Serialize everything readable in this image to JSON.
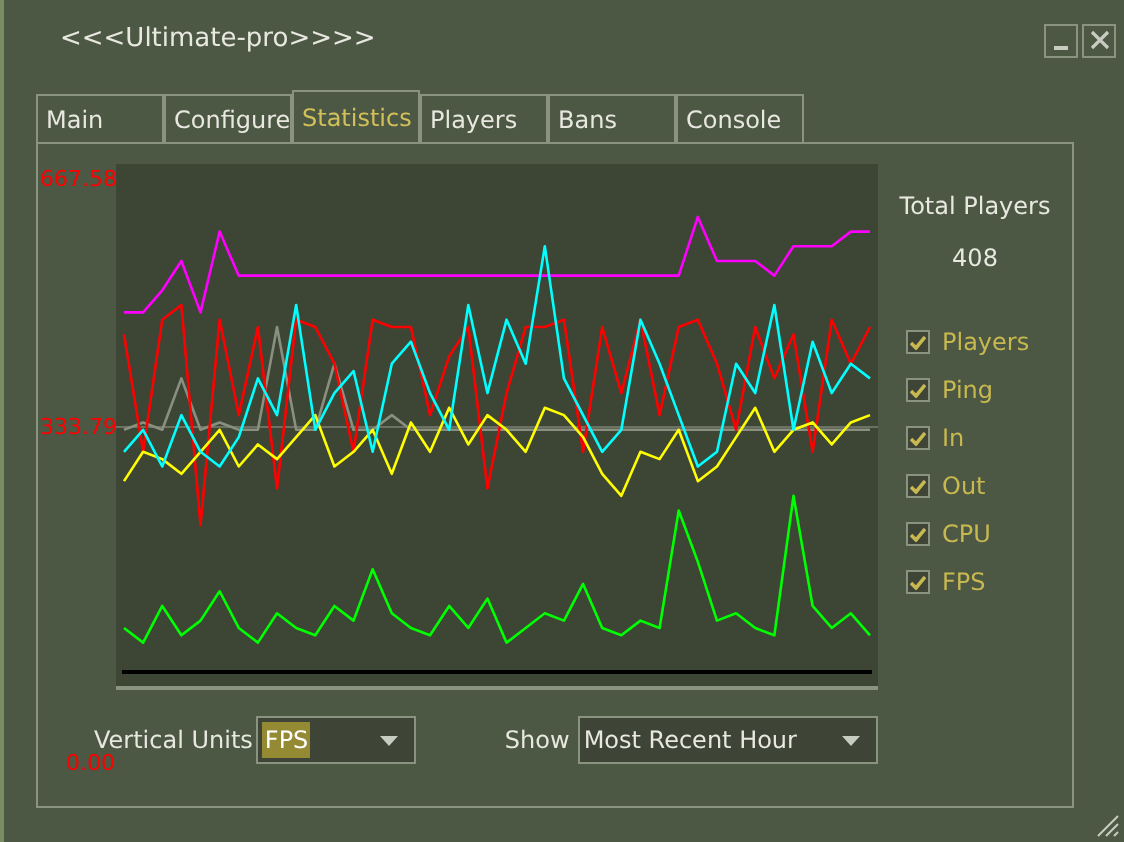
{
  "window": {
    "title": "<<<Ultimate-pro>>>>"
  },
  "tabs": [
    {
      "label": "Main",
      "selected": false
    },
    {
      "label": "Configure",
      "selected": false
    },
    {
      "label": "Statistics",
      "selected": true
    },
    {
      "label": "Players",
      "selected": false
    },
    {
      "label": "Bans",
      "selected": false
    },
    {
      "label": "Console",
      "selected": false
    }
  ],
  "chart": {
    "y_labels": [
      "667.58",
      "333.79",
      "0.00"
    ]
  },
  "total_players": {
    "label": "Total Players",
    "value": "408"
  },
  "toggles": [
    {
      "label": "Players",
      "checked": true
    },
    {
      "label": "Ping",
      "checked": true
    },
    {
      "label": "In",
      "checked": true
    },
    {
      "label": "Out",
      "checked": true
    },
    {
      "label": "CPU",
      "checked": true
    },
    {
      "label": "FPS",
      "checked": true
    }
  ],
  "vertical_units": {
    "label": "Vertical Units",
    "value": "FPS"
  },
  "show": {
    "label": "Show",
    "value": "Most Recent Hour"
  }
}
